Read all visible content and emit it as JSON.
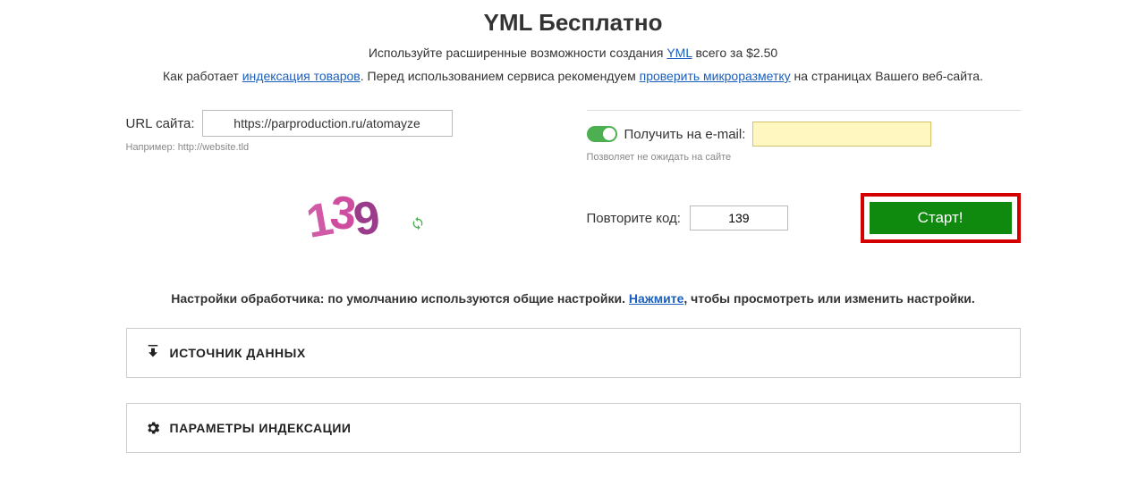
{
  "title": "YML Бесплатно",
  "sub1": {
    "pre": "Используйте расширенные возможности создания ",
    "link": "YML",
    "post": " всего за $2.50"
  },
  "sub2": {
    "pre": "Как работает ",
    "link1": "индексация товаров",
    "mid": ". Перед использованием сервиса рекомендуем ",
    "link2": "проверить микроразметку",
    "post": " на страницах Вашего веб-сайта."
  },
  "url": {
    "label": "URL сайта:",
    "value": "https://parproduction.ru/atomayze",
    "hint": "Например: http://website.tld"
  },
  "email": {
    "label": "Получить на e-mail:",
    "value": "",
    "hint": "Позволяет не ожидать на сайте"
  },
  "captcha": {
    "label": "Повторите код:",
    "value": "139",
    "d1": "1",
    "d2": "3",
    "d3": "9"
  },
  "start": "Старт!",
  "settings_note": {
    "pre": "Настройки обработчика: по умолчанию используются общие настройки. ",
    "link": "Нажмите",
    "post": ", чтобы просмотреть или изменить настройки."
  },
  "panels": {
    "p1": "ИСТОЧНИК ДАННЫХ",
    "p2": "ПАРАМЕТРЫ ИНДЕКСАЦИИ"
  }
}
